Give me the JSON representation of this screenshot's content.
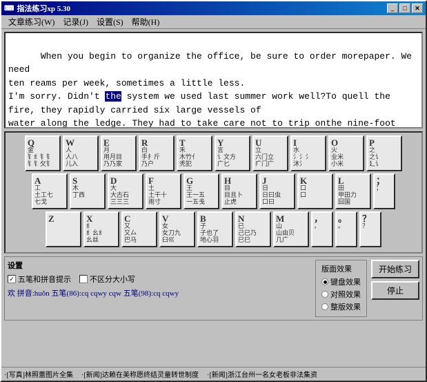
{
  "window": {
    "title": "指法练习xp 5.30",
    "icon": "⌨"
  },
  "menu": {
    "items": [
      {
        "label": "文章练习(W)",
        "id": "article"
      },
      {
        "label": "记录(J)",
        "id": "record"
      },
      {
        "label": "设置(S)",
        "id": "settings"
      },
      {
        "label": "帮助(H)",
        "id": "help"
      }
    ]
  },
  "text_content": "When you begin to organize the office, be sure to order morepaper. We need\nten reams per week, sometimes a little less.\nI'm sorry. Didn't the system we used last summer work well?To quell the\nfire, they rapidly carried six large vessels of\nwater along the ledge. They had to take care not to trip onthe nine-foot\nwire that ran between the two secured doors.",
  "keyboard": {
    "rows": [
      [
        {
          "letter": "Q",
          "top": "金",
          "chars": "钅钅钅钅\n钅钅钅钅"
        },
        {
          "letter": "W",
          "top": "人",
          "chars": "人八\n儿入"
        },
        {
          "letter": "E",
          "top": "月",
          "chars": "用月目\n乃乃家"
        },
        {
          "letter": "R",
          "top": "白",
          "chars": "手扌斤\n乃门户"
        },
        {
          "letter": "T",
          "top": "禾",
          "chars": "木竹亻\n秃犯"
        },
        {
          "letter": "Y",
          "top": "言",
          "chars": "讠文方\n广匕艹"
        },
        {
          "letter": "U",
          "top": "立",
          "chars": "六〉立\n疒门门广"
        },
        {
          "letter": "I",
          "top": "水",
          "chars": "氵氵氵氵\n沐氵"
        },
        {
          "letter": "O",
          "top": "火",
          "chars": "业米\n小米"
        },
        {
          "letter": "P",
          "top": "之",
          "chars": "之\n廴讠"
        }
      ],
      [
        {
          "letter": "A",
          "top": "工",
          "chars": "土工\n七戈"
        },
        {
          "letter": "S",
          "top": "木",
          "chars": "丁西\n"
        },
        {
          "letter": "D",
          "top": "大",
          "chars": "大古石\n三三三"
        },
        {
          "letter": "F",
          "top": "土",
          "chars": "土干十\n雨寸"
        },
        {
          "letter": "G",
          "top": "王",
          "chars": "王一五\n一五戋"
        },
        {
          "letter": "H",
          "top": "目",
          "chars": "目且\n卜止虎"
        },
        {
          "letter": "J",
          "top": "日",
          "chars": "日曰虫\n口曰口"
        },
        {
          "letter": "K",
          "top": "口",
          "chars": "口\n"
        },
        {
          "letter": "L",
          "top": "田",
          "chars": "甲田力\n囧国"
        },
        {
          "letter": "SEMI",
          "top": ";",
          "chars": ";\n"
        }
      ],
      [
        {
          "letter": "Z",
          "top": "",
          "chars": "\n"
        },
        {
          "letter": "X",
          "top": "纟",
          "chars": "纟幺纟\n幺丝幺"
        },
        {
          "letter": "C",
          "top": "又",
          "chars": "又厶\n巴马"
        },
        {
          "letter": "V",
          "top": "女",
          "chars": "女刀九\n臼巛"
        },
        {
          "letter": "B",
          "top": "子",
          "chars": "子也了\n地心羽"
        },
        {
          "letter": "N",
          "top": "已",
          "chars": "己已\n乃已巳"
        },
        {
          "letter": "M",
          "top": "山",
          "chars": "山由贝\n几儿广"
        },
        {
          "letter": "COMMA",
          "top": "，",
          "chars": "，\n"
        },
        {
          "letter": "DOT",
          "top": "。",
          "chars": "。\n"
        },
        {
          "letter": "SLASH",
          "top": "？",
          "chars": "？\n"
        }
      ]
    ]
  },
  "settings": {
    "title": "设置",
    "checkbox1_label": "五笔和拼音提示",
    "checkbox1_checked": true,
    "checkbox2_label": "不区分大小写",
    "checkbox2_checked": false,
    "status_line": "欢  拼音:huǒn  五笔(86):cq  cqwy  cqw  五笔(98):cq  cqwy",
    "effects_title": "版面效果",
    "radio_items": [
      {
        "label": "键盘效果",
        "selected": true
      },
      {
        "label": "对照效果",
        "selected": false
      },
      {
        "label": "整版效果",
        "selected": false
      }
    ],
    "btn_start": "开始练习",
    "btn_stop": "停止"
  },
  "status_bar": {
    "items": [
      "·[写真]林照蕾图片全集",
      "·[新闻]达赖在美称愿终结灵童转世制度",
      "·[新闻]浙江台州一名女老板非法集资"
    ]
  },
  "title_buttons": {
    "minimize": "_",
    "maximize": "□",
    "close": "✕"
  }
}
